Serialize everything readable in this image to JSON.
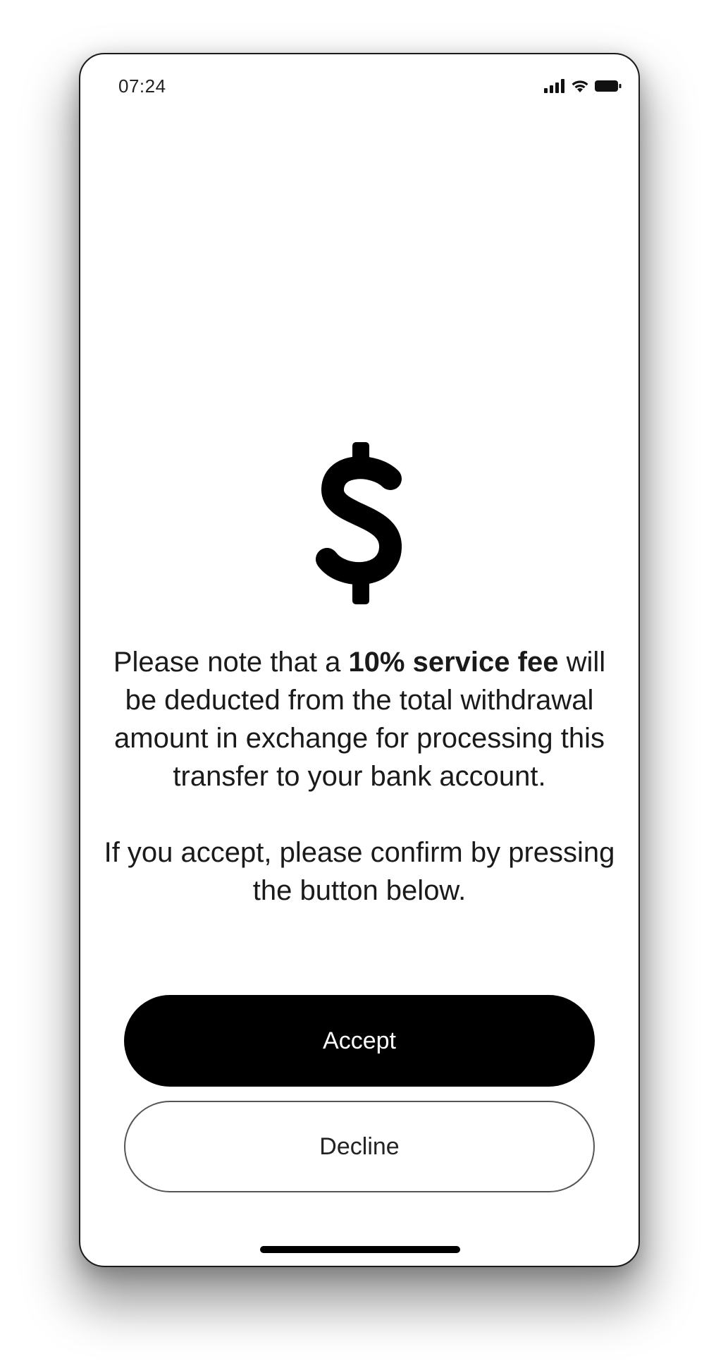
{
  "status_bar": {
    "time": "07:24",
    "icons": [
      "cellular-signal-icon",
      "wifi-icon",
      "battery-icon"
    ]
  },
  "main": {
    "icon": "dollar-icon",
    "message": {
      "line1_prefix": "Please note that a ",
      "fee_highlight": "10% service fee",
      "line1_suffix": " will be deducted from the total withdrawal amount in exchange for processing this transfer to your bank account.",
      "confirm_text": "If you accept, please confirm by pressing the button below."
    }
  },
  "actions": {
    "accept_label": "Accept",
    "decline_label": "Decline"
  },
  "colors": {
    "primary": "#000000",
    "background": "#ffffff",
    "text": "#1a1a1a"
  }
}
